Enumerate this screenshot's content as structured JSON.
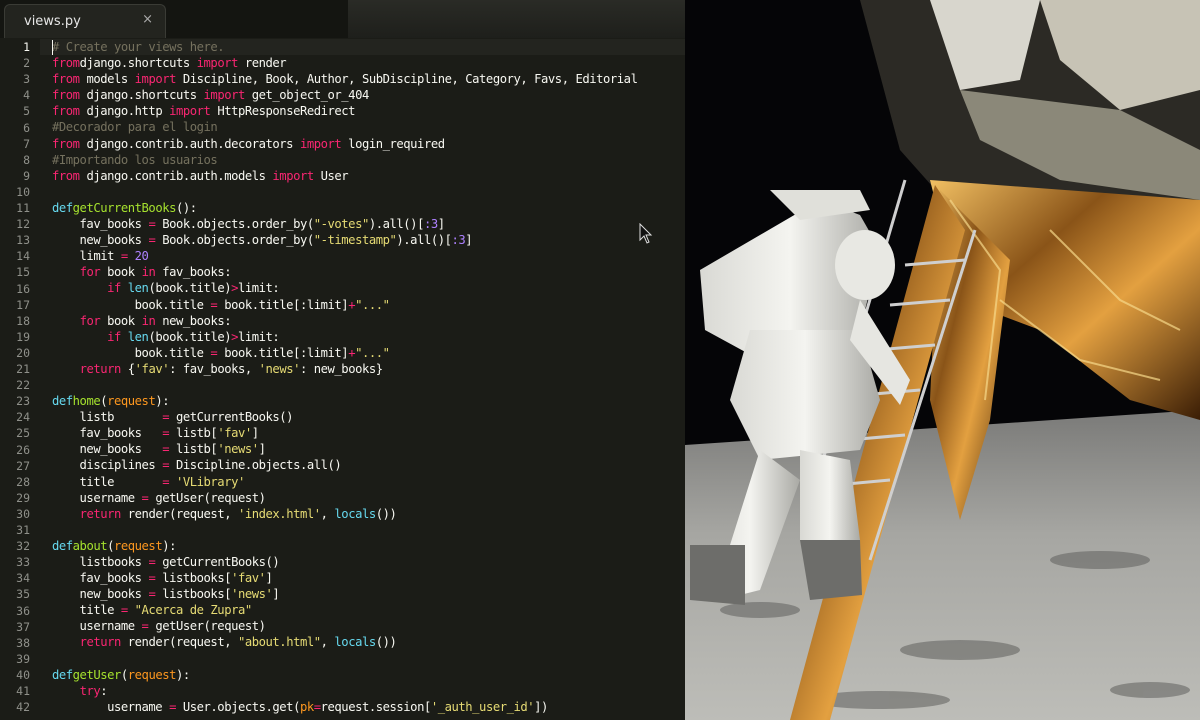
{
  "editor": {
    "tab": {
      "label": "views.py",
      "close": "×"
    },
    "active_line": 1,
    "line_numbers": [
      "1",
      "2",
      "3",
      "4",
      "5",
      "6",
      "7",
      "8",
      "9",
      "10",
      "11",
      "12",
      "13",
      "14",
      "15",
      "16",
      "17",
      "18",
      "19",
      "20",
      "21",
      "22",
      "23",
      "24",
      "25",
      "26",
      "27",
      "28",
      "29",
      "30",
      "31",
      "32",
      "33",
      "34",
      "35",
      "36",
      "37",
      "38",
      "39",
      "40",
      "41",
      "42"
    ],
    "code_lines": [
      [
        [
          "c",
          "# Create your views here."
        ]
      ],
      [
        [
          "k",
          "from"
        ],
        [
          "",
          "django.shortcuts "
        ],
        [
          "k",
          "import"
        ],
        [
          "",
          " render"
        ]
      ],
      [
        [
          "k",
          "from"
        ],
        [
          "",
          " models "
        ],
        [
          "k",
          "import"
        ],
        [
          "",
          " Discipline, Book, Author, SubDiscipline, Category, Favs, Editorial"
        ]
      ],
      [
        [
          "k",
          "from"
        ],
        [
          "",
          " django.shortcuts "
        ],
        [
          "k",
          "import"
        ],
        [
          "",
          " get_object_or_404"
        ]
      ],
      [
        [
          "k",
          "from"
        ],
        [
          "",
          " django.http "
        ],
        [
          "k",
          "import"
        ],
        [
          "",
          " HttpResponseRedirect"
        ]
      ],
      [
        [
          "c",
          "#Decorador para el login"
        ]
      ],
      [
        [
          "k",
          "from"
        ],
        [
          "",
          " django.contrib.auth.decorators "
        ],
        [
          "k",
          "import"
        ],
        [
          "",
          " login_required"
        ]
      ],
      [
        [
          "c",
          "#Importando los usuarios"
        ]
      ],
      [
        [
          "k",
          "from"
        ],
        [
          "",
          " django.contrib.auth.models "
        ],
        [
          "k",
          "import"
        ],
        [
          "",
          " User"
        ]
      ],
      [],
      [
        [
          "d",
          "def"
        ],
        [
          " ",
          ""
        ],
        [
          "f",
          "getCurrentBooks"
        ],
        [
          "",
          "():"
        ]
      ],
      [
        [
          "",
          "    fav_books "
        ],
        [
          "k",
          "="
        ],
        [
          "",
          " Book.objects.order_by("
        ],
        [
          "s",
          "\"-votes\""
        ],
        [
          "",
          ").all()["
        ],
        [
          "n",
          ":3"
        ],
        [
          "",
          "]"
        ]
      ],
      [
        [
          "",
          "    new_books "
        ],
        [
          "k",
          "="
        ],
        [
          "",
          " Book.objects.order_by("
        ],
        [
          "s",
          "\"-timestamp\""
        ],
        [
          "",
          ").all()["
        ],
        [
          "n",
          ":3"
        ],
        [
          "",
          "]"
        ]
      ],
      [
        [
          "",
          "    limit "
        ],
        [
          "k",
          "="
        ],
        [
          "",
          " "
        ],
        [
          "n",
          "20"
        ]
      ],
      [
        [
          "",
          "    "
        ],
        [
          "k",
          "for"
        ],
        [
          "",
          " book "
        ],
        [
          "k",
          "in"
        ],
        [
          "",
          " fav_books:"
        ]
      ],
      [
        [
          "",
          "        "
        ],
        [
          "k",
          "if"
        ],
        [
          "",
          " "
        ],
        [
          "d",
          "len"
        ],
        [
          "",
          "(book.title)"
        ],
        [
          "k",
          ">"
        ],
        [
          "",
          "limit:"
        ]
      ],
      [
        [
          "",
          "            book.title "
        ],
        [
          "k",
          "="
        ],
        [
          "",
          " book.title[:limit]"
        ],
        [
          "k",
          "+"
        ],
        [
          "s",
          "\"...\""
        ]
      ],
      [
        [
          "",
          "    "
        ],
        [
          "k",
          "for"
        ],
        [
          "",
          " book "
        ],
        [
          "k",
          "in"
        ],
        [
          "",
          " new_books:"
        ]
      ],
      [
        [
          "",
          "        "
        ],
        [
          "k",
          "if"
        ],
        [
          "",
          " "
        ],
        [
          "d",
          "len"
        ],
        [
          "",
          "(book.title)"
        ],
        [
          "k",
          ">"
        ],
        [
          "",
          "limit:"
        ]
      ],
      [
        [
          "",
          "            book.title "
        ],
        [
          "k",
          "="
        ],
        [
          "",
          " book.title[:limit]"
        ],
        [
          "k",
          "+"
        ],
        [
          "s",
          "\"...\""
        ]
      ],
      [
        [
          "",
          "    "
        ],
        [
          "k",
          "return"
        ],
        [
          "",
          " {"
        ],
        [
          "s",
          "'fav'"
        ],
        [
          "",
          ": fav_books, "
        ],
        [
          "s",
          "'news'"
        ],
        [
          "",
          ": new_books}"
        ]
      ],
      [],
      [
        [
          "d",
          "def"
        ],
        [
          " ",
          ""
        ],
        [
          "f",
          "home"
        ],
        [
          "",
          "("
        ],
        [
          "p",
          "request"
        ],
        [
          "",
          "):"
        ]
      ],
      [
        [
          "",
          "    listb       "
        ],
        [
          "k",
          "="
        ],
        [
          "",
          " getCurrentBooks()"
        ]
      ],
      [
        [
          "",
          "    fav_books   "
        ],
        [
          "k",
          "="
        ],
        [
          "",
          " listb["
        ],
        [
          "s",
          "'fav'"
        ],
        [
          "",
          "]"
        ]
      ],
      [
        [
          "",
          "    new_books   "
        ],
        [
          "k",
          "="
        ],
        [
          "",
          " listb["
        ],
        [
          "s",
          "'news'"
        ],
        [
          "",
          "]"
        ]
      ],
      [
        [
          "",
          "    disciplines "
        ],
        [
          "k",
          "="
        ],
        [
          "",
          " Discipline.objects.all()"
        ]
      ],
      [
        [
          "",
          "    title       "
        ],
        [
          "k",
          "="
        ],
        [
          "",
          " "
        ],
        [
          "s",
          "'VLibrary'"
        ]
      ],
      [
        [
          "",
          "    username "
        ],
        [
          "k",
          "="
        ],
        [
          "",
          " getUser(request)"
        ]
      ],
      [
        [
          "",
          "    "
        ],
        [
          "k",
          "return"
        ],
        [
          "",
          " render(request, "
        ],
        [
          "s",
          "'index.html'"
        ],
        [
          "",
          ", "
        ],
        [
          "d",
          "locals"
        ],
        [
          "",
          "())"
        ]
      ],
      [],
      [
        [
          "d",
          "def"
        ],
        [
          " ",
          ""
        ],
        [
          "f",
          "about"
        ],
        [
          "",
          "("
        ],
        [
          "p",
          "request"
        ],
        [
          "",
          "):"
        ]
      ],
      [
        [
          "",
          "    listbooks "
        ],
        [
          "k",
          "="
        ],
        [
          "",
          " getCurrentBooks()"
        ]
      ],
      [
        [
          "",
          "    fav_books "
        ],
        [
          "k",
          "="
        ],
        [
          "",
          " listbooks["
        ],
        [
          "s",
          "'fav'"
        ],
        [
          "",
          "]"
        ]
      ],
      [
        [
          "",
          "    new_books "
        ],
        [
          "k",
          "="
        ],
        [
          "",
          " listbooks["
        ],
        [
          "s",
          "'news'"
        ],
        [
          "",
          "]"
        ]
      ],
      [
        [
          "",
          "    title "
        ],
        [
          "k",
          "="
        ],
        [
          "",
          " "
        ],
        [
          "s",
          "\"Acerca de Zupra\""
        ]
      ],
      [
        [
          "",
          "    username "
        ],
        [
          "k",
          "="
        ],
        [
          "",
          " getUser(request)"
        ]
      ],
      [
        [
          "",
          "    "
        ],
        [
          "k",
          "return"
        ],
        [
          "",
          " render(request, "
        ],
        [
          "s",
          "\"about.html\""
        ],
        [
          "",
          ", "
        ],
        [
          "d",
          "locals"
        ],
        [
          "",
          "())"
        ]
      ],
      [],
      [
        [
          "d",
          "def"
        ],
        [
          " ",
          ""
        ],
        [
          "f",
          "getUser"
        ],
        [
          "",
          "("
        ],
        [
          "p",
          "request"
        ],
        [
          "",
          "):"
        ]
      ],
      [
        [
          "",
          "    "
        ],
        [
          "k",
          "try"
        ],
        [
          "",
          ":"
        ]
      ],
      [
        [
          "",
          "        username "
        ],
        [
          "k",
          "="
        ],
        [
          "",
          " User.objects.get("
        ],
        [
          "p",
          "pk"
        ],
        [
          "k",
          "="
        ],
        [
          "",
          "request.session["
        ],
        [
          "s",
          "'_auth_user_id'"
        ],
        [
          "",
          "])"
        ]
      ]
    ]
  },
  "colors": {
    "editor_bg": "#1b1c17",
    "keyword": "#f92672",
    "builtin": "#66d9ef",
    "function": "#a6e22e",
    "string": "#e6db74",
    "number": "#ae81ff",
    "comment": "#75715e",
    "parameter": "#fd971f"
  },
  "icons": {
    "cursor": "mouse-pointer-icon",
    "close": "close-icon"
  }
}
